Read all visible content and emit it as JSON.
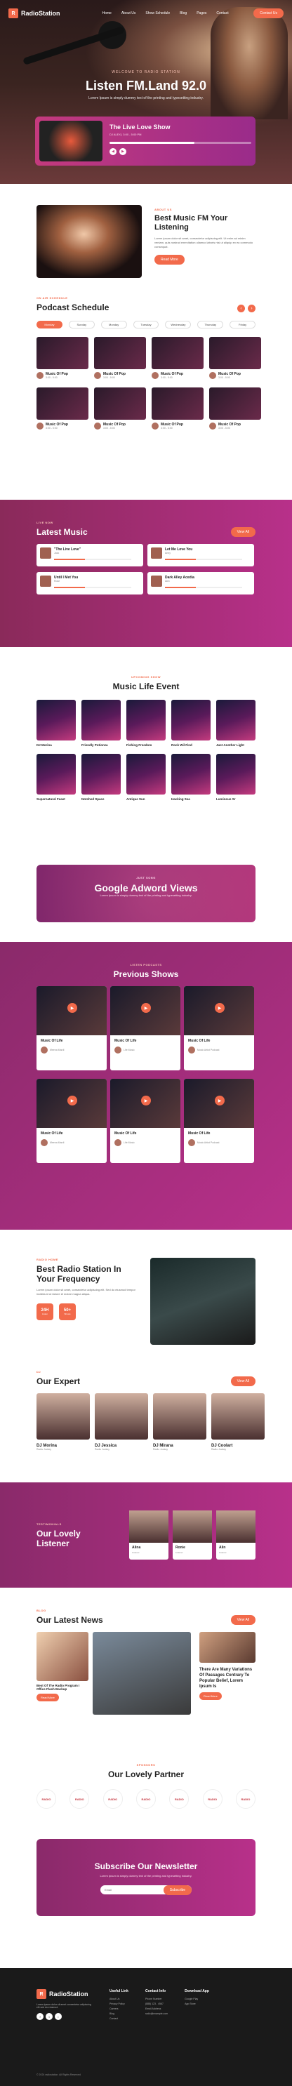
{
  "nav": {
    "brand": "RadioStation",
    "brand_mark": "R",
    "items": [
      "Home",
      "About Us",
      "Show Schedule",
      "Blog",
      "Pages",
      "Contact"
    ],
    "cta": "Contact Us"
  },
  "hero": {
    "kicker": "WELCOME TO RADIO STATION",
    "title": "Listen FM.Land 92.0",
    "subtitle": "Lorem Ipsum is simply dummy text of the printing and typesetting industry."
  },
  "player": {
    "title": "The Live Love Show",
    "meta": "DJ ALEX | 3:00 - 5:00 PM",
    "progress": 0.6
  },
  "about": {
    "kicker": "ABOUT US",
    "title": "Best Music FM Your Listening",
    "body": "Lorem ipsum dolor sit amet, consectetur adipiscing elit. Ut enim ad minim veniam, quis nostrud exercitation ullamco laboris nisi ut aliquip ex ea commodo consequat.",
    "button": "Read More"
  },
  "schedule": {
    "kicker": "ON AIR SCHEDULE",
    "title": "Podcast Schedule",
    "days": [
      "Monday",
      "Sunday",
      "Monday",
      "Tuesday",
      "Wednesday",
      "Thursday",
      "Friday"
    ],
    "cards": [
      {
        "t": "Music Of Pop",
        "s": "3:00 - 5:00"
      },
      {
        "t": "Music Of Pop",
        "s": "3:00 - 5:00"
      },
      {
        "t": "Music Of Pop",
        "s": "3:00 - 5:00"
      },
      {
        "t": "Music Of Pop",
        "s": "3:00 - 5:00"
      },
      {
        "t": "Music Of Pop",
        "s": "3:00 - 5:00"
      },
      {
        "t": "Music Of Pop",
        "s": "3:00 - 5:00"
      },
      {
        "t": "Music Of Pop",
        "s": "3:00 - 5:00"
      },
      {
        "t": "Music Of Pop",
        "s": "3:00 - 5:00"
      }
    ]
  },
  "latest": {
    "kicker": "LIVE NOW",
    "title": "Latest Music",
    "button": "View All",
    "cards": [
      {
        "t": "\"The Live Love\"",
        "s": "Jack"
      },
      {
        "t": "Let Me Love You",
        "s": "Anny"
      },
      {
        "t": "Until I Met You",
        "s": "Rose"
      },
      {
        "t": "Dark Alley Acedia",
        "s": "Alex"
      }
    ]
  },
  "events": {
    "kicker": "UPCOMING SHOW",
    "title": "Music Life Event",
    "cards": [
      "DJ Morina",
      "Friendly Potionza",
      "Fishing Freedom",
      "Rock Wil Find",
      "Just Another Light",
      "Supernatural Feast",
      "Notched Space",
      "Antique Sun",
      "Hacking Sea",
      "Luminous Sr"
    ]
  },
  "banner": {
    "kicker": "JUST SONG",
    "title": "Google Adword Views",
    "body": "Lorem Ipsum is simply dummy text of the printing and typesetting industry."
  },
  "previous": {
    "kicker": "LISTEN PODCASTS",
    "title": "Previous Shows",
    "cards": [
      {
        "t": "Music Of Life",
        "s": "Meena Mardi"
      },
      {
        "t": "Music Of Life",
        "s": "Life Music"
      },
      {
        "t": "Music Of Life",
        "s": "Music Artist Podcast"
      },
      {
        "t": "Music Of Life",
        "s": "Meena Mardi"
      },
      {
        "t": "Music Of Life",
        "s": "Life Music"
      },
      {
        "t": "Music Of Life",
        "s": "Music Artist Podcast"
      }
    ]
  },
  "studio": {
    "kicker": "RADIO HOME",
    "title": "Best Radio Station In Your Frequency",
    "body": "Lorem ipsum dolor sit amet, consectetur adipiscing elit. Sed do eiusmod tempor incididunt ut labore et dolore magna aliqua.",
    "stats": [
      {
        "n": "24H",
        "l": "Listen"
      },
      {
        "n": "50+",
        "l": "Shows"
      }
    ]
  },
  "experts": {
    "kicker": "DJ",
    "title": "Our Expert",
    "button": "View All",
    "cards": [
      {
        "t": "DJ Morina",
        "s": "Radio Jockey"
      },
      {
        "t": "DJ Jessica",
        "s": "Radio Jockey"
      },
      {
        "t": "DJ Mirana",
        "s": "Radio Jockey"
      },
      {
        "t": "DJ Coolart",
        "s": "Radio Jockey"
      }
    ]
  },
  "listener": {
    "kicker": "TESTIMONIALS",
    "title": "Our Lovely Listener",
    "cards": [
      {
        "t": "Alina",
        "s": "Listener"
      },
      {
        "t": "Ronie",
        "s": "Listener"
      },
      {
        "t": "Alin",
        "s": "Listener"
      }
    ]
  },
  "news": {
    "kicker": "BLOG",
    "title": "Our Latest News",
    "button": "View All",
    "cards": [
      {
        "t": "Best Of The Radio Program I Office Flash Backup"
      },
      {
        "t": "There Are Many Variations Of Passages Contrary To Popular Belief, Lorem Ipsum Is"
      }
    ],
    "read": "Read More"
  },
  "partners": {
    "kicker": "SPONSORS",
    "title": "Our Lovely Partner",
    "logos": [
      "RADIO",
      "RADIO",
      "RADIO",
      "RADIO",
      "RADIO",
      "RADIO",
      "RADIO"
    ]
  },
  "newsletter": {
    "title": "Subscribe Our Newsletter",
    "body": "Lorem Ipsum is simply dummy text of the printing and typesetting industry.",
    "placeholder": "Email",
    "button": "Subscribe"
  },
  "footer": {
    "about": "Lorem ipsum dolor sit amet consectetur adipiscing elit sed do eiusmod.",
    "cols": [
      {
        "h": "Useful Link",
        "i": [
          "About Us",
          "Privacy Policy",
          "Careers",
          "Blog",
          "Contact"
        ]
      },
      {
        "h": "Contact Info",
        "i": [
          "Phone Number",
          "(888) 123 - 4567",
          "Email Address",
          "radio@example.com"
        ]
      },
      {
        "h": "Download App",
        "i": [
          "Google Play",
          "App Store"
        ]
      }
    ],
    "copyright": "© 2024 radiostation. All Rights Reserved"
  }
}
